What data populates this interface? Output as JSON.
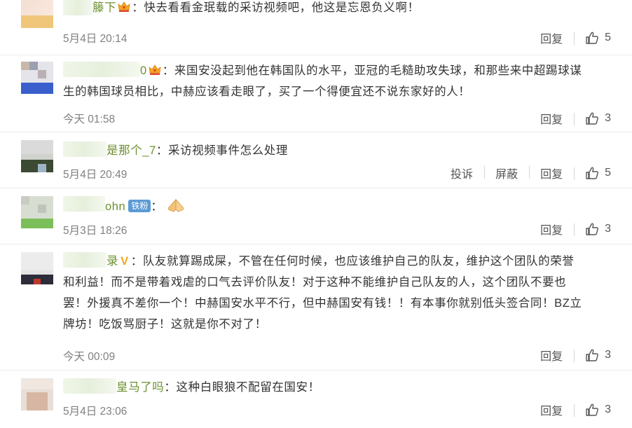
{
  "colors": {
    "nick": "#6b8f2e",
    "time": "#808080",
    "text": "#333333",
    "badge": "#5b9bd5"
  },
  "comments": [
    {
      "nick": "籐下",
      "sep": "：",
      "text": "快去看看金珉载的采访视频吧，他这是忘恩负义啊！",
      "time": "5月4日 20:14",
      "actions": [
        "回复"
      ],
      "likes": "5",
      "icons": [
        "crown-icon"
      ]
    },
    {
      "nick": "0",
      "sep": "：",
      "text": "来国安没起到他在韩国队的水平，亚冠的毛糙助攻失球，和那些来中超踢球谋",
      "text2": "生的韩国球员相比，中赫应该看走眼了，买了一个得便宜还不说东家好的人！",
      "time": "今天 01:58",
      "actions": [
        "回复"
      ],
      "likes": "3",
      "icons": [
        "crown-icon"
      ]
    },
    {
      "nick": "是那个_7",
      "sep": "：",
      "text": "采访视频事件怎么处理",
      "time": "5月4日 20:49",
      "actions": [
        "投诉",
        "屏蔽",
        "回复"
      ],
      "likes": "5"
    },
    {
      "nick": "ohn",
      "badge": "铁粉",
      "sep": "：",
      "text": "",
      "time": "5月3日 18:26",
      "actions": [
        "回复"
      ],
      "likes": "3",
      "icons": [
        "praying-hands-emoji"
      ]
    },
    {
      "nick": "录",
      "vmark": "V",
      "sep": "：",
      "lines": [
        "队友就算踢成屎，不管在任何时候，也应该维护自己的队友，维护这个团队的荣誉",
        "和利益！而不是带着戏虐的口气去评价队友！对于这种不能维护自己队友的人，这个团队不要也",
        "罢！外援真不差你一个！中赫国安水平不行，但中赫国安有钱！！有本事你就别低头签合同！BZ立",
        "牌坊！吃饭骂厨子！这就是你不对了！"
      ],
      "time": "今天 00:09",
      "actions": [
        "回复"
      ],
      "likes": "3"
    },
    {
      "nick": "皇马了吗",
      "sep": "：",
      "text": "这种白眼狼不配留在国安！",
      "time": "5月4日 23:06",
      "actions": [
        "回复"
      ],
      "likes": "3"
    }
  ]
}
